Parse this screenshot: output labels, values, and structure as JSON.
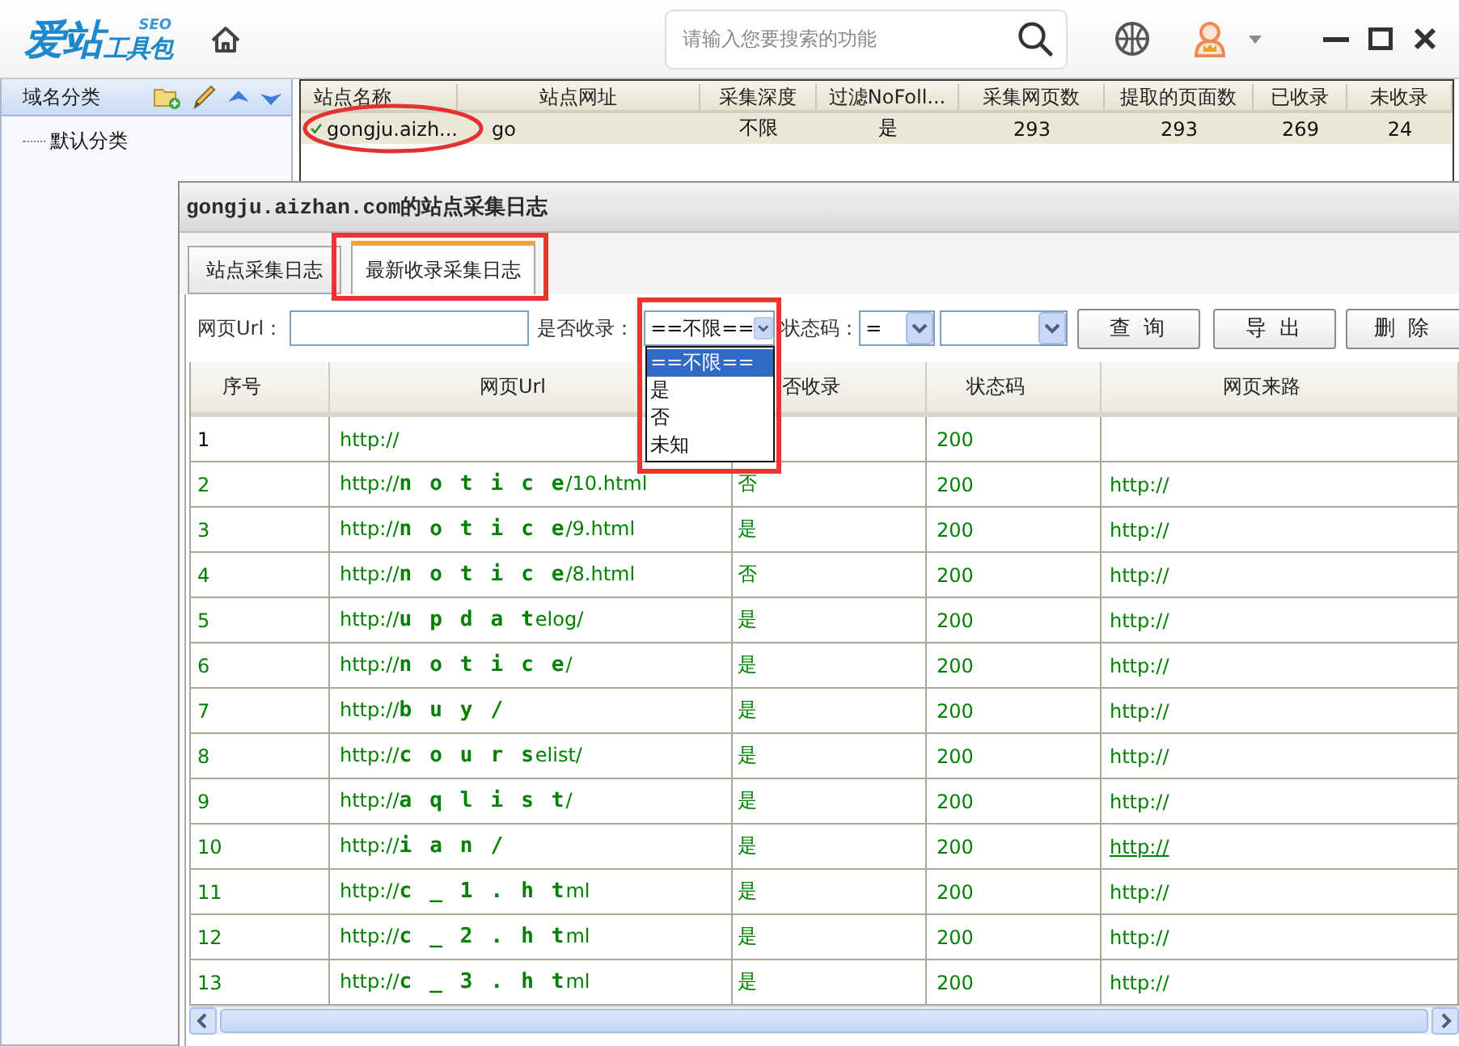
{
  "app": {
    "logo": {
      "brand": "爱站",
      "badge": "SEO",
      "product": "工具包"
    },
    "search": {
      "placeholder": "请输入您要搜索的功能"
    }
  },
  "sidebar": {
    "title": "域名分类",
    "items": [
      {
        "label": "默认分类",
        "selected": false
      }
    ]
  },
  "sites": {
    "columns": [
      "站点名称",
      "站点网址",
      "采集深度",
      "过滤NoFoll...",
      "采集网页数",
      "提取的页面数",
      "已收录",
      "未收录"
    ],
    "rows": [
      {
        "checked": true,
        "selected": true,
        "circled": true,
        "cells": [
          "gongju.aizh...",
          "go",
          "不限",
          "是",
          "293",
          "293",
          "269",
          "24"
        ]
      }
    ]
  },
  "dialog": {
    "title": "gongju.aizhan.com的站点采集日志",
    "tabs": [
      {
        "label": "站点采集日志",
        "selected": false,
        "highlighted": false
      },
      {
        "label": "最新收录采集日志",
        "selected": true,
        "highlighted": true
      }
    ],
    "filters": {
      "url": {
        "label": "网页Url："
      },
      "indexed": {
        "label": "是否收录：",
        "value": "==不限==",
        "expanded": true,
        "highlighted": true,
        "options": [
          {
            "label": "==不限==",
            "selected": true
          },
          {
            "label": "是",
            "selected": false
          },
          {
            "label": "否",
            "selected": false
          },
          {
            "label": "未知",
            "selected": false
          }
        ]
      },
      "status": {
        "label": "状态码：",
        "operator": "="
      }
    },
    "buttons": [
      "查 询",
      "导 出",
      "删 除"
    ],
    "table": {
      "columns": [
        "序号",
        "网页Url",
        "否收录",
        "状态码",
        "网页来路"
      ],
      "rows": [
        {
          "number": "1",
          "color": "#000000",
          "url": "http://",
          "status": "200",
          "hovered": false
        },
        {
          "number": "2",
          "color": "#008000",
          "url": "http://**notice**/10.html",
          "indexed": "否",
          "status": "200",
          "referer": "http://",
          "hovered": false
        },
        {
          "number": "3",
          "color": "#008000",
          "url": "http://**notice**/9.html",
          "indexed": "是",
          "status": "200",
          "referer": "http://",
          "hovered": false
        },
        {
          "number": "4",
          "color": "#008000",
          "url": "http://**notice**/8.html",
          "indexed": "否",
          "status": "200",
          "referer": "http://",
          "hovered": false
        },
        {
          "number": "5",
          "color": "#008000",
          "url": "http://**updat**elog/",
          "indexed": "是",
          "status": "200",
          "referer": "http://",
          "hovered": false
        },
        {
          "number": "6",
          "color": "#008000",
          "url": "http://**notice**/",
          "indexed": "是",
          "status": "200",
          "referer": "http://",
          "hovered": false
        },
        {
          "number": "7",
          "color": "#008000",
          "url": "http://**buy/**",
          "indexed": "是",
          "status": "200",
          "referer": "http://",
          "hovered": false
        },
        {
          "number": "8",
          "color": "#008000",
          "url": "http://**cours**elist/",
          "indexed": "是",
          "status": "200",
          "referer": "http://",
          "hovered": false
        },
        {
          "number": "9",
          "color": "#008000",
          "url": "http://**aqlist**/",
          "indexed": "是",
          "status": "200",
          "referer": "http://",
          "hovered": false
        },
        {
          "number": "10",
          "color": "#008000",
          "url": "http://**ian/**",
          "indexed": "是",
          "status": "200",
          "referer": "http://",
          "hovered": true
        },
        {
          "number": "11",
          "color": "#008000",
          "url": "http://**c_1.ht**ml",
          "indexed": "是",
          "status": "200",
          "referer": "http://",
          "hovered": false
        },
        {
          "number": "12",
          "color": "#008000",
          "url": "http://**c_2.ht**ml",
          "indexed": "是",
          "status": "200",
          "referer": "http://",
          "hovered": false
        },
        {
          "number": "13",
          "color": "#008000",
          "url": "http://**c_3.ht**ml",
          "indexed": "是",
          "status": "200",
          "referer": "http://",
          "hovered": false
        }
      ]
    }
  }
}
